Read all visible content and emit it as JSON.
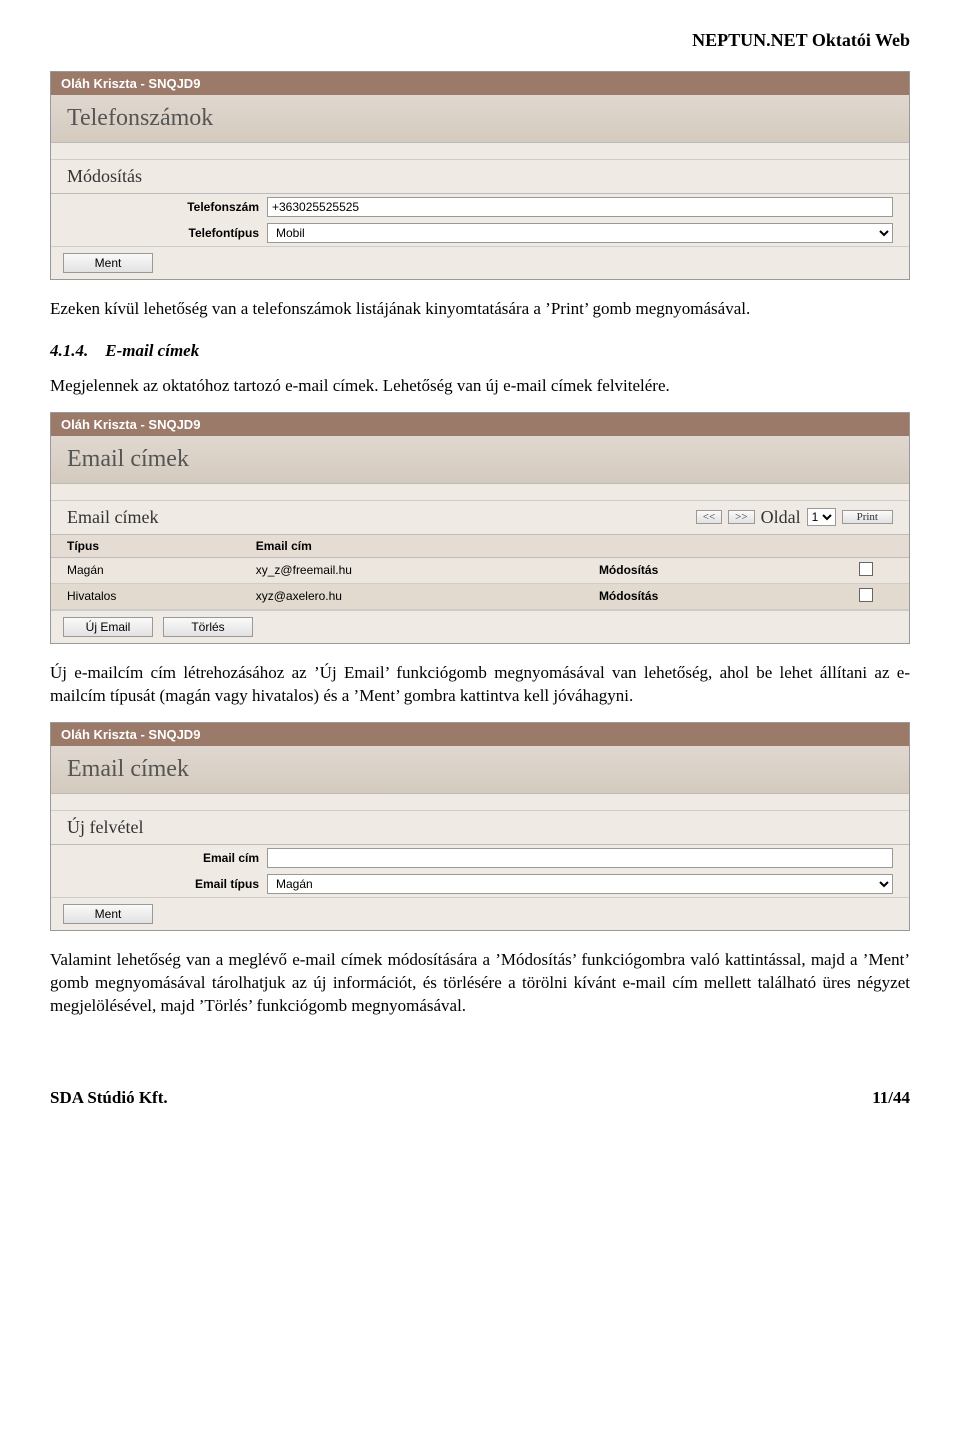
{
  "header": {
    "title": "NEPTUN.NET Oktatói Web"
  },
  "user": {
    "name_code": "Oláh Kriszta - SNQJD9"
  },
  "shot1": {
    "big_title": "Telefonszámok",
    "section_title": "Módosítás",
    "fields": {
      "telefon_label": "Telefonszám",
      "telefon_value": "+363025525525",
      "tipus_label": "Telefontípus",
      "tipus_value": "Mobil"
    },
    "save_btn": "Ment"
  },
  "para1": "Ezeken kívül lehetőség van a telefonszámok listájának kinyomtatására a ’Print’ gomb megnyomásával.",
  "section_414": {
    "num": "4.1.4.",
    "title": "E-mail címek",
    "para": "Megjelennek az oktatóhoz tartozó e-mail címek. Lehetőség van új e-mail címek felvitelére."
  },
  "shot2": {
    "big_title": "Email címek",
    "list_title": "Email címek",
    "pager": {
      "prev": "<<",
      "next": ">>",
      "label": "Oldal",
      "page": "1",
      "print": "Print"
    },
    "cols": {
      "type": "Típus",
      "email": "Email cím",
      "mod": "",
      "chk": ""
    },
    "rows": [
      {
        "type": "Magán",
        "email": "xy_z@freemail.hu",
        "mod": "Módosítás"
      },
      {
        "type": "Hivatalos",
        "email": "xyz@axelero.hu",
        "mod": "Módosítás"
      }
    ],
    "btn_new": "Új Email",
    "btn_del": "Törlés"
  },
  "para2": "Új e-mailcím cím létrehozásához az ’Új Email’ funkciógomb megnyomásával van lehetőség, ahol be lehet állítani az e-mailcím típusát (magán vagy hivatalos) és a ’Ment’ gombra kattintva kell jóváhagyni.",
  "shot3": {
    "big_title": "Email címek",
    "section_title": "Új felvétel",
    "fields": {
      "email_label": "Email cím",
      "email_value": "",
      "tipus_label": "Email típus",
      "tipus_value": "Magán"
    },
    "save_btn": "Ment"
  },
  "para3": "Valamint lehetőség van a meglévő e-mail címek módosítására a ’Módosítás’ funkciógombra való kattintással, majd a ’Ment’ gomb megnyomásával tárolhatjuk az új információt, és törlésére a törölni kívánt e-mail cím mellett található üres négyzet megjelölésével, majd ’Törlés’ funkciógomb megnyomásával.",
  "footer": {
    "left": "SDA Stúdió Kft.",
    "right": "11/44"
  }
}
